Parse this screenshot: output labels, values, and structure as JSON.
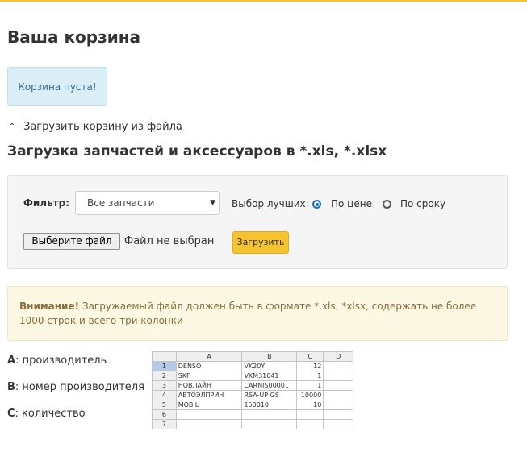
{
  "cart": {
    "title": "Ваша корзина",
    "empty_message": "Корзина пуста!"
  },
  "load_toggle": {
    "label": "Загрузить корзину из файла",
    "icon": "chevron-up-icon"
  },
  "upload_section": {
    "title": "Загрузка запчастей и аксессуаров в *.xls, *.xlsx",
    "filter_label": "Фильтр:",
    "filter_selected": "Все запчасти",
    "best_label": "Выбор лучших:",
    "radio_price": "По цене",
    "radio_term": "По сроку",
    "radio_selected": "price",
    "file_button": "Выберите файл",
    "file_status": "Файл не выбран",
    "upload_button": "Загрузить"
  },
  "warning": {
    "strong": "Внимание!",
    "text": " Загружаемый файл должен быть в формате *.xls, *xlsx, содержать не более 1000 строк и всего три колонки"
  },
  "columns_help": [
    {
      "key": "A",
      "desc": ": производитель"
    },
    {
      "key": "B",
      "desc": ": номер производителя"
    },
    {
      "key": "C",
      "desc": ": количество"
    }
  ],
  "spreadsheet": {
    "headers": [
      "",
      "A",
      "B",
      "C",
      "D"
    ],
    "rows": [
      {
        "n": "1",
        "a": "DENSO",
        "b": "VK20Y",
        "c": "12"
      },
      {
        "n": "2",
        "a": "SKF",
        "b": "VKM31041",
        "c": "1"
      },
      {
        "n": "3",
        "a": "НОВЛАЙН",
        "b": "CARNIS00001",
        "c": "1"
      },
      {
        "n": "4",
        "a": "АВТОЭЛПРИН",
        "b": "RSA-UP GS",
        "c": "10000"
      },
      {
        "n": "5",
        "a": "MOBIL",
        "b": "150010",
        "c": "10"
      },
      {
        "n": "6",
        "a": "",
        "b": "",
        "c": ""
      },
      {
        "n": "7",
        "a": "",
        "b": "",
        "c": ""
      }
    ]
  },
  "colors": {
    "accent": "#f6c330",
    "info_bg": "#dbeef7",
    "warning_bg": "#fcf8e3",
    "radio_selected": "#1e73be"
  }
}
